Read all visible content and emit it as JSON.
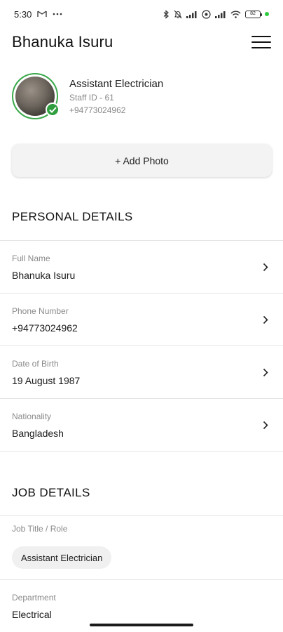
{
  "status_bar": {
    "time": "5:30",
    "battery": "82"
  },
  "header": {
    "title": "Bhanuka Isuru"
  },
  "profile": {
    "role": "Assistant Electrician",
    "staff_id": "Staff ID - 61",
    "phone": "+94773024962"
  },
  "add_photo": {
    "label": "+ Add Photo"
  },
  "personal": {
    "title": "PERSONAL DETAILS",
    "rows": [
      {
        "label": "Full Name",
        "value": "Bhanuka Isuru"
      },
      {
        "label": "Phone Number",
        "value": "+94773024962"
      },
      {
        "label": "Date of Birth",
        "value": "19 August 1987"
      },
      {
        "label": "Nationality",
        "value": "Bangladesh"
      }
    ]
  },
  "job": {
    "title": "JOB DETAILS",
    "role_label": "Job Title / Role",
    "role_chip": "Assistant Electrician",
    "department_label": "Department",
    "department_value": "Electrical"
  },
  "colors": {
    "accent_green": "#2e9e3e",
    "ring_green": "#3aa84a",
    "chip_bg": "#f0f0f0"
  }
}
